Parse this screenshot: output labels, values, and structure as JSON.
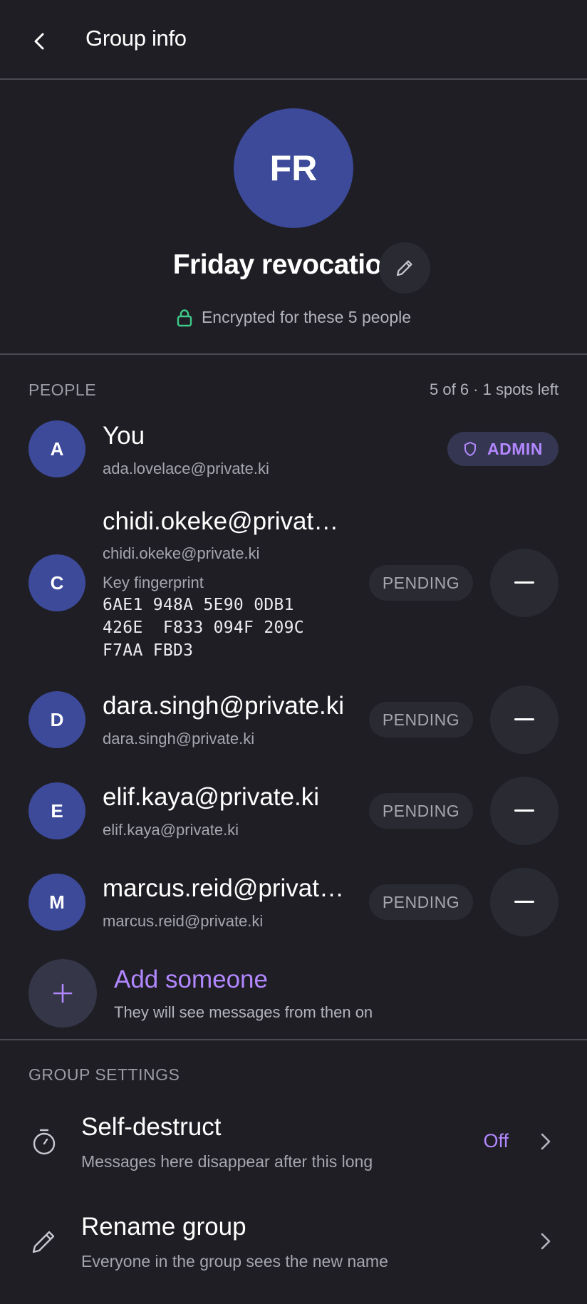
{
  "header": {
    "title": "Group info",
    "back_icon": "chevron-left-icon"
  },
  "group": {
    "initials": "FR",
    "name": "Friday revocation",
    "encryption_text": "Encrypted for these 5 people",
    "avatar_color": "#3d4a9a"
  },
  "people": {
    "section_label": "PEOPLE",
    "count_text": "5 of 6 · 1 spots left",
    "members": [
      {
        "initial": "A",
        "name": "You",
        "email": "ada.lovelace@private.ki",
        "badge": "ADMIN"
      },
      {
        "initial": "C",
        "name": "chidi.okeke@private…",
        "email": "chidi.okeke@private.ki",
        "fingerprint_label": "Key fingerprint",
        "fingerprint_lines": [
          "6AE1 948A 5E90 0DB1",
          "426E  F833 094F 209C",
          "F7AA FBD3"
        ],
        "status": "PENDING"
      },
      {
        "initial": "D",
        "name": "dara.singh@private.ki",
        "email": "dara.singh@private.ki",
        "status": "PENDING"
      },
      {
        "initial": "E",
        "name": "elif.kaya@private.ki",
        "email": "elif.kaya@private.ki",
        "status": "PENDING"
      },
      {
        "initial": "M",
        "name": "marcus.reid@privat…",
        "email": "marcus.reid@private.ki",
        "status": "PENDING"
      }
    ],
    "add": {
      "title": "Add someone",
      "subtitle": "They will see messages from then on"
    }
  },
  "settings": {
    "section_label": "GROUP SETTINGS",
    "items": [
      {
        "title": "Self-destruct",
        "subtitle": "Messages here disappear after this long",
        "value": "Off",
        "icon": "timer-icon"
      },
      {
        "title": "Rename group",
        "subtitle": "Everyone in the group sees the new name",
        "icon": "pencil-icon"
      }
    ]
  },
  "colors": {
    "background": "#1e1e24",
    "accent": "#b287ff",
    "encryption_lock": "#3ec98a",
    "avatar": "#3d4a9a"
  }
}
